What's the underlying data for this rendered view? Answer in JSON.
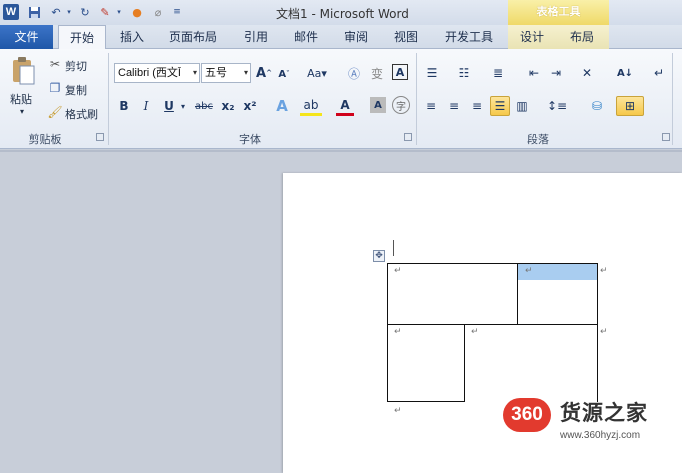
{
  "window": {
    "title": "文档1 - Microsoft Word",
    "app_icon_letter": "W",
    "contextual_header": "表格工具"
  },
  "tabs": {
    "file": "文件",
    "home": "开始",
    "insert": "插入",
    "page_layout": "页面布局",
    "references": "引用",
    "mailings": "邮件",
    "review": "审阅",
    "view": "视图",
    "developer": "开发工具",
    "design": "设计",
    "layout": "布局"
  },
  "clipboard": {
    "paste": "粘贴",
    "cut": "剪切",
    "copy": "复制",
    "format_painter": "格式刷",
    "group_label": "剪贴板"
  },
  "font": {
    "font_name": "Calibri (西文Ī",
    "font_size": "五号",
    "bold": "B",
    "italic": "I",
    "underline": "U",
    "strikethrough": "abc",
    "subscript": "x₂",
    "superscript": "x²",
    "grow": "A",
    "shrink": "A",
    "change_case": "Aa",
    "group_label": "字体"
  },
  "paragraph": {
    "group_label": "段落"
  },
  "watermark": {
    "badge": "360",
    "name": "货源之家",
    "url": "www.360hyzj.com"
  },
  "colors": {
    "accent_blue": "#2b579a",
    "file_tab": "#1f57a8",
    "contextual_gold": "#efd968",
    "selected_cell": "#a9cdf0",
    "watermark_red": "#e23a2e"
  }
}
